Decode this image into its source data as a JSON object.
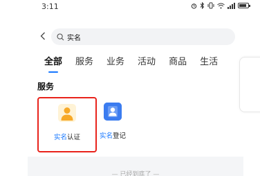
{
  "status_bar": {
    "time": "3:11",
    "icons": [
      "alarm-icon",
      "bluetooth-icon",
      "vibrate-icon",
      "wifi-icon",
      "signal-icon",
      "battery-icon"
    ]
  },
  "search": {
    "value": "实名",
    "back_icon": "chevron-left-icon",
    "search_icon": "search-icon"
  },
  "tabs": [
    {
      "label": "全部",
      "active": true
    },
    {
      "label": "服务",
      "active": false
    },
    {
      "label": "业务",
      "active": false
    },
    {
      "label": "活动",
      "active": false
    },
    {
      "label": "商品",
      "active": false
    },
    {
      "label": "生活",
      "active": false
    }
  ],
  "section": {
    "title": "服务"
  },
  "services": [
    {
      "highlight": "实名",
      "rest": "认证",
      "icon": "user-icon",
      "selected": true
    },
    {
      "highlight": "实名",
      "rest": "登记",
      "icon": "id-card-icon",
      "selected": false
    }
  ],
  "footer": {
    "text": "— 已经到底了 —"
  },
  "colors": {
    "accent": "#1677ff",
    "highlight_border": "#e8221b",
    "orange_icon": "#f7a928",
    "blue_icon": "#3b7cf0"
  }
}
